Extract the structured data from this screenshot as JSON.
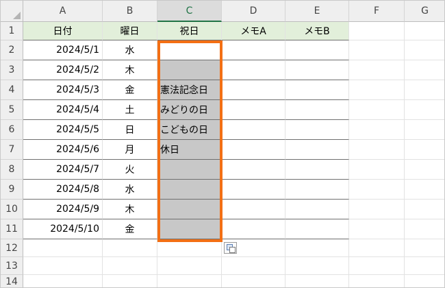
{
  "columns": [
    "A",
    "B",
    "C",
    "D",
    "E",
    "F",
    "G"
  ],
  "rows": [
    "1",
    "2",
    "3",
    "4",
    "5",
    "6",
    "7",
    "8",
    "9",
    "10",
    "11",
    "12",
    "13",
    "14"
  ],
  "table": {
    "headers": [
      "日付",
      "曜日",
      "祝日",
      "メモA",
      "メモB"
    ],
    "data": [
      {
        "date": "2024/5/1",
        "weekday": "水",
        "holiday": ""
      },
      {
        "date": "2024/5/2",
        "weekday": "木",
        "holiday": ""
      },
      {
        "date": "2024/5/3",
        "weekday": "金",
        "holiday": "憲法記念日"
      },
      {
        "date": "2024/5/4",
        "weekday": "土",
        "holiday": "みどりの日"
      },
      {
        "date": "2024/5/5",
        "weekday": "日",
        "holiday": "こどもの日"
      },
      {
        "date": "2024/5/6",
        "weekday": "月",
        "holiday": "休日"
      },
      {
        "date": "2024/5/7",
        "weekday": "火",
        "holiday": ""
      },
      {
        "date": "2024/5/8",
        "weekday": "水",
        "holiday": ""
      },
      {
        "date": "2024/5/9",
        "weekday": "木",
        "holiday": ""
      },
      {
        "date": "2024/5/10",
        "weekday": "金",
        "holiday": ""
      }
    ]
  },
  "selection": {
    "highlight_color": "#f36f14",
    "fill_color": "#c8c8c8",
    "header_fill": "#e2efda"
  },
  "icons": {
    "paste_options": "paste-options-icon"
  }
}
